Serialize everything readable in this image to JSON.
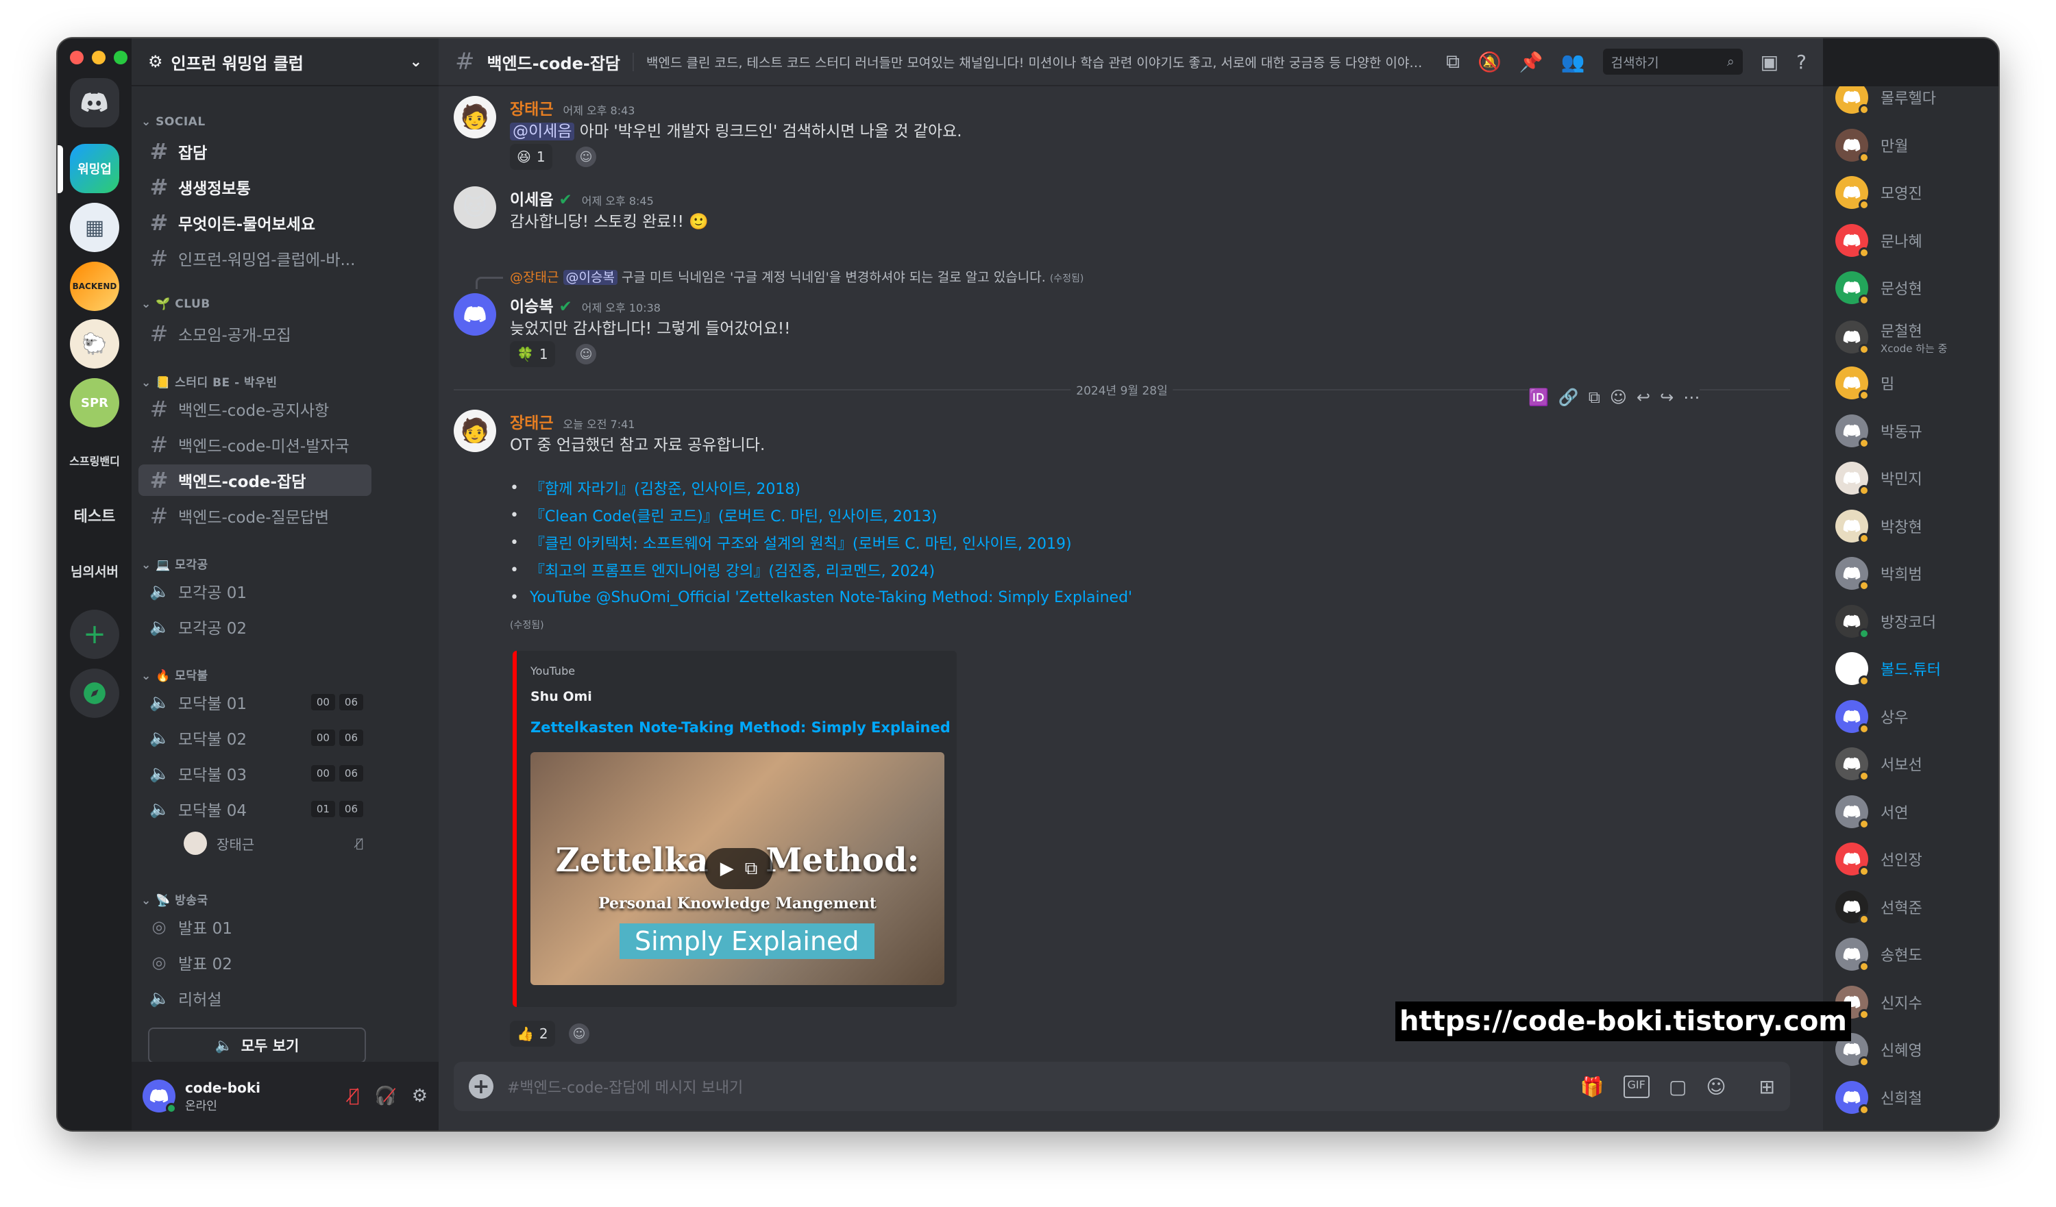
{
  "server": {
    "name": "인프런 워밍업 클럽"
  },
  "server_rail": {
    "text1": "스프링밴디",
    "text2": "테스트",
    "text3": "님의서버"
  },
  "categories": {
    "social": "SOCIAL",
    "club": "CLUB",
    "study": "스터디 BE - 박우빈",
    "mogakgong": "모각공",
    "modakbul": "모닥불",
    "broadcast": "방송국"
  },
  "channels": {
    "social": [
      "잡담",
      "생생정보통",
      "무엇이든-물어보세요",
      "인프런-워밍업-클럽에-바..."
    ],
    "club": [
      "소모임-공개-모집"
    ],
    "study": [
      "백엔드-code-공지사항",
      "백엔드-code-미션-발자국",
      "백엔드-code-잡담",
      "백엔드-code-질문답변"
    ],
    "mogakgong": [
      "모각공 01",
      "모각공 02"
    ],
    "modakbul": [
      {
        "name": "모닥불 01",
        "a": "00",
        "b": "06"
      },
      {
        "name": "모닥불 02",
        "a": "00",
        "b": "06"
      },
      {
        "name": "모닥불 03",
        "a": "00",
        "b": "06"
      },
      {
        "name": "모닥불 04",
        "a": "01",
        "b": "06"
      }
    ],
    "voice_user": "장태근",
    "broadcast": [
      "발표 01",
      "발표 02",
      "리허설"
    ]
  },
  "see_all": "모두 보기",
  "user": {
    "name": "code-boki",
    "status": "온라인"
  },
  "header": {
    "channel": "백엔드-code-잡담",
    "topic": "백엔드 클린 코드, 테스트 코드 스터디 러너들만 모여있는 채널입니다! 미션이나 학습 관련 이야기도 좋고, 서로에 대한 궁금증 등 다양한 이야기를 나눠보세요.",
    "search_placeholder": "검색하기"
  },
  "messages": {
    "m1": {
      "author": "장태근",
      "time": "어제 오후 8:43",
      "mention": "@이세음",
      "text": " 아마 '박우빈 개발자 링크드인' 검색하시면 나올 것 같아요.",
      "reaction_count": "1"
    },
    "m2": {
      "author": "이세음",
      "time": "어제 오후 8:45",
      "text": "감사합니당! 스토킹 완료!! 🙂"
    },
    "m3": {
      "reply_author": "@장태근",
      "reply_mention": "@이승복",
      "reply_text": " 구글 미트 닉네임은 '구글 계정 닉네임'을 변경하셔야 되는 걸로 알고 있습니다.",
      "reply_edited": "(수정됨)",
      "author": "이승복",
      "time": "어제 오후 10:38",
      "text": "늦었지만 감사합니다! 그렇게 들어갔어요!!",
      "reaction_count": "1"
    },
    "date_divider": "2024년 9월 28일",
    "m4": {
      "author": "장태근",
      "time": "오늘 오전 7:41",
      "text": "OT 중 언급했던 참고 자료 공유합니다.",
      "links": [
        "『함께 자라기』(김창준, 인사이트, 2018)",
        "『Clean Code(클린 코드)』(로버트 C. 마틴, 인사이트, 2013)",
        "『클린 아키텍처: 소프트웨어 구조와 설계의 원칙』(로버트 C. 마틴, 인사이트, 2019)",
        "『최고의 프롬프트 엔지니어링 강의』(김진중, 리코멘드, 2024)",
        "YouTube @ShuOmi_Official 'Zettelkasten Note-Taking Method: Simply Explained'"
      ],
      "edited": "(수정됨)",
      "embed": {
        "provider": "YouTube",
        "author": "Shu Omi",
        "title": "Zettelkasten Note-Taking Method: Simply Explained",
        "thumb_line1": "Zettelka",
        "thumb_line1b": "Method:",
        "thumb_line2": "Personal Knowledge Mangement",
        "thumb_line3": "Simply Explained"
      },
      "reaction_count": "2"
    }
  },
  "composer_placeholder": "#백엔드-code-잡담에 메시지 보내기",
  "watermark": "https://code-boki.tistory.com",
  "members": [
    {
      "name": "몰루헬다",
      "color": "#f0b232",
      "status": "#f0b232"
    },
    {
      "name": "만월",
      "color": "#6d4c41",
      "status": "#f0b232"
    },
    {
      "name": "모영진",
      "color": "#f0b232",
      "status": "#f0b232"
    },
    {
      "name": "문나혜",
      "color": "#f23f43",
      "status": "#f0b232"
    },
    {
      "name": "문성현",
      "color": "#23a55a",
      "status": "#f0b232"
    },
    {
      "name": "문철현",
      "sub": "Xcode 하는 중",
      "color": "#444",
      "status": "#f0b232"
    },
    {
      "name": "밈",
      "color": "#f0b232",
      "status": "#f0b232"
    },
    {
      "name": "박동규",
      "color": "#80848e",
      "status": "#f0b232"
    },
    {
      "name": "박민지",
      "color": "#e8e0d8",
      "status": "#f0b232"
    },
    {
      "name": "박창현",
      "color": "#e8dcc0",
      "status": "#f0b232"
    },
    {
      "name": "박희범",
      "color": "#80848e",
      "status": "#f0b232"
    },
    {
      "name": "방장코더",
      "color": "#3a3a3a",
      "status": "#23a55a"
    },
    {
      "name": "볼드.튜터",
      "color": "#ffffff",
      "status": "#f0b232",
      "highlight": true
    },
    {
      "name": "상우",
      "color": "#5865f2",
      "status": "#f0b232"
    },
    {
      "name": "서보선",
      "color": "#555",
      "status": "#f0b232"
    },
    {
      "name": "서연",
      "color": "#80848e",
      "status": "#f0b232"
    },
    {
      "name": "선인장",
      "color": "#f23f43",
      "status": "#f0b232"
    },
    {
      "name": "선혁준",
      "color": "#222",
      "status": "#f0b232"
    },
    {
      "name": "송현도",
      "color": "#80848e",
      "status": "#f0b232"
    },
    {
      "name": "신지수",
      "color": "#8d6e63",
      "status": "#f0b232"
    },
    {
      "name": "신혜영",
      "color": "#80848e",
      "status": "#f0b232"
    },
    {
      "name": "신희철",
      "color": "#5865f2",
      "status": "#f0b232"
    }
  ],
  "colors": {
    "accent": "#5865f2",
    "author_orange": "#e67e22",
    "link": "#00a8fc",
    "online": "#23a55a",
    "idle": "#f0b232"
  }
}
